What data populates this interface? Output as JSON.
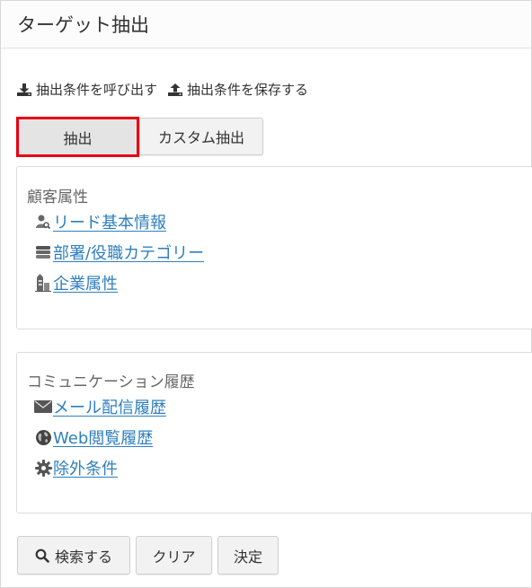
{
  "title": "ターゲット抽出",
  "tools": {
    "load_label": "抽出条件を呼び出す",
    "save_label": "抽出条件を保存する"
  },
  "modes": {
    "extract_label": "抽出",
    "custom_label": "カスタム抽出"
  },
  "customer_section": {
    "title": "顧客属性",
    "links": [
      {
        "label": "リード基本情報",
        "icon": "user-search-icon"
      },
      {
        "label": "部署/役職カテゴリー",
        "icon": "stack-icon"
      },
      {
        "label": "企業属性",
        "icon": "building-icon"
      }
    ]
  },
  "communication_section": {
    "title": "コミュニケーション履歴",
    "links": [
      {
        "label": "メール配信履歴",
        "icon": "envelope-icon"
      },
      {
        "label": "Web閲覧履歴",
        "icon": "globe-icon"
      },
      {
        "label": "除外条件",
        "icon": "gear-icon"
      }
    ]
  },
  "actions": {
    "search_label": "検索する",
    "clear_label": "クリア",
    "decide_label": "決定"
  },
  "colors": {
    "link": "#2f7fbf",
    "highlight_border": "#e60012"
  }
}
